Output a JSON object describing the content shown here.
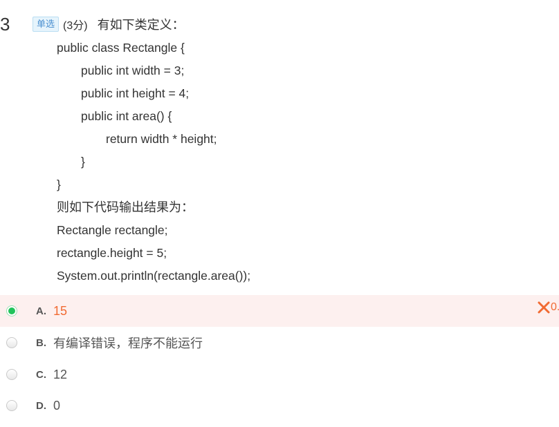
{
  "question": {
    "number": "3",
    "type_badge": "单选",
    "score": "(3分)",
    "stem_title": "有如下类定义：",
    "code_lines": [
      "public class Rectangle {",
      "public int width = 3;",
      "public int height = 4;",
      "public int area() {",
      "return width * height;",
      "}",
      "}",
      "则如下代码输出结果为：",
      "Rectangle rectangle;",
      "rectangle.height = 5;",
      "System.out.println(rectangle.area());"
    ]
  },
  "options": [
    {
      "letter": "A.",
      "text": "15",
      "selected": true
    },
    {
      "letter": "B.",
      "text": "有编译错误，程序不能运行",
      "selected": false
    },
    {
      "letter": "C.",
      "text": "12",
      "selected": false
    },
    {
      "letter": "D.",
      "text": "0",
      "selected": false
    }
  ],
  "result": {
    "icon": "cross-icon",
    "score": "0.",
    "color": "#f16a32"
  },
  "colors": {
    "selected_row_bg": "#fdf0ef",
    "radio_checked": "#21c35b",
    "badge_text": "#4a8fcf",
    "badge_bg": "#e6f4fc",
    "answer_text": "#f16a32"
  }
}
